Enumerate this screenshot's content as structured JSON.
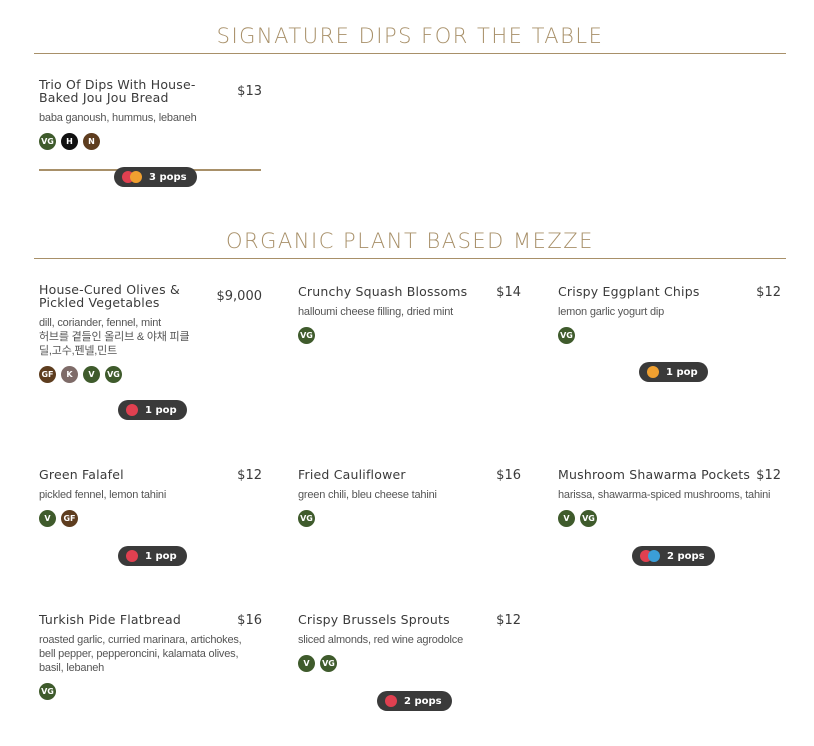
{
  "sections": [
    {
      "title": "SIGNATURE DIPS FOR THE TABLE"
    },
    {
      "title": "ORGANIC PLANT BASED MEZZE"
    }
  ],
  "items": [
    {
      "name": "Trio Of Dips With House-Baked Jou Jou Bread",
      "price": "$13",
      "desc": "baba ganoush, hummus, lebaneh",
      "badges": [
        "VG",
        "H",
        "N"
      ]
    },
    {
      "name": "House-Cured Olives & Pickled Vegetables",
      "price": "$9,000",
      "desc": "dill, coriander, fennel, mint",
      "desc2": "허브를 곁들인 올리브 & 야채 피클",
      "desc3": "딜,고수,펜넬,민트",
      "badges": [
        "GF",
        "K",
        "V",
        "VG"
      ]
    },
    {
      "name": "Crunchy Squash Blossoms",
      "price": "$14",
      "desc": "halloumi cheese filling, dried mint",
      "badges": [
        "VG"
      ]
    },
    {
      "name": "Crispy Eggplant Chips",
      "price": "$12",
      "desc": "lemon garlic yogurt dip",
      "badges": [
        "VG"
      ]
    },
    {
      "name": "Green Falafel",
      "price": "$12",
      "desc": "pickled fennel, lemon tahini",
      "badges": [
        "V",
        "GF"
      ]
    },
    {
      "name": "Fried Cauliflower",
      "price": "$16",
      "desc": "green chili, bleu cheese tahini",
      "badges": [
        "VG"
      ]
    },
    {
      "name": "Mushroom Shawarma Pockets",
      "price": "$12",
      "desc": "harissa, shawarma-spiced mushrooms, tahini",
      "badges": [
        "V",
        "VG"
      ]
    },
    {
      "name": "Turkish Pide Flatbread",
      "price": "$16",
      "desc": "roasted garlic, curried marinara, artichokes, bell pepper, pepperoncini, kalamata olives, basil, lebaneh",
      "badges": [
        "VG"
      ]
    },
    {
      "name": "Crispy Brussels Sprouts",
      "price": "$12",
      "desc": "sliced almonds, red wine agrodolce",
      "badges": [
        "V",
        "VG"
      ]
    }
  ],
  "pops": [
    {
      "label": "3 pops",
      "icons": [
        "heart-icon",
        "thumbs-up-icon"
      ]
    },
    {
      "label": "1 pop",
      "icons": [
        "heart-icon"
      ]
    },
    {
      "label": "1 pop",
      "icons": [
        "thumbs-up-icon"
      ]
    },
    {
      "label": "1 pop",
      "icons": [
        "heart-icon"
      ]
    },
    {
      "label": "2 pops",
      "icons": [
        "heart-icon",
        "laugh-icon"
      ]
    },
    {
      "label": "2 pops",
      "icons": [
        "heart-icon"
      ]
    }
  ],
  "colors": {
    "accent": "#a89069",
    "badge_green": "#3f5b2c",
    "badge_brown": "#5e3d1f",
    "pill": "#3a3a3a"
  }
}
